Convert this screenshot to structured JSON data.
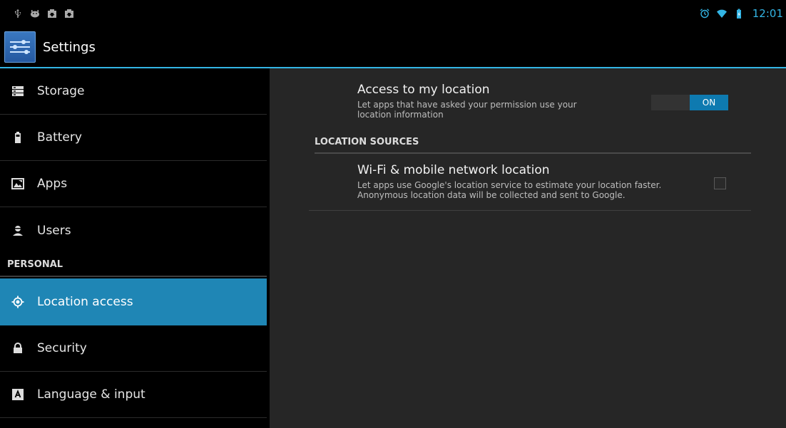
{
  "status_bar": {
    "left_icons": [
      "usb-icon",
      "android-debug-icon",
      "download-icon",
      "download-icon"
    ],
    "right_icons": [
      "alarm-icon",
      "wifi-icon",
      "battery-charging-icon"
    ],
    "time": "12:01",
    "accent": "#33b5e5"
  },
  "action_bar": {
    "app_icon": "settings-sliders-icon",
    "title": "Settings"
  },
  "sidebar": {
    "items_top": [
      {
        "label": "Storage",
        "icon": "storage-icon"
      },
      {
        "label": "Battery",
        "icon": "battery-icon"
      },
      {
        "label": "Apps",
        "icon": "apps-icon"
      },
      {
        "label": "Users",
        "icon": "users-icon"
      }
    ],
    "section_personal": "PERSONAL",
    "items_personal": [
      {
        "label": "Location access",
        "icon": "location-icon",
        "selected": true
      },
      {
        "label": "Security",
        "icon": "lock-icon"
      },
      {
        "label": "Language & input",
        "icon": "language-icon"
      }
    ],
    "active_color": "#1f86b5"
  },
  "detail": {
    "access": {
      "title": "Access to my location",
      "summary_line1": "Let apps that have asked your permission use your",
      "summary_line2": "location information",
      "toggle_label": "ON",
      "toggle_on": true
    },
    "category": "LOCATION SOURCES",
    "wifi": {
      "title": "Wi-Fi & mobile network location",
      "summary_line1": "Let apps use Google's location service to estimate your location faster.",
      "summary_line2": "Anonymous location data will be collected and sent to Google.",
      "checked": false
    }
  }
}
